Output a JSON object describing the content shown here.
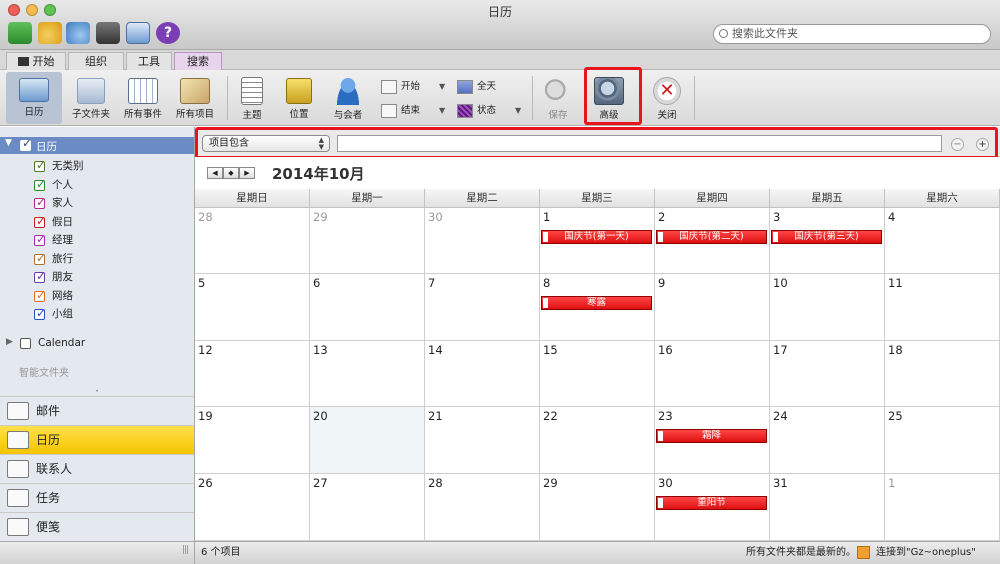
{
  "window": {
    "title": "日历"
  },
  "toolbar": {
    "search_placeholder": "搜索此文件夹",
    "icons": [
      "sync-icon",
      "undo-icon",
      "redo-icon",
      "print-icon",
      "calendar-view-icon",
      "help-icon"
    ]
  },
  "tabs": [
    {
      "label": "开始"
    },
    {
      "label": "组织"
    },
    {
      "label": "工具"
    },
    {
      "label": "搜索",
      "active": true
    }
  ],
  "ribbon": {
    "scope": [
      {
        "label": "日历",
        "icon": "calendar-folder-icon"
      },
      {
        "label": "子文件夹",
        "icon": "subfolder-icon"
      },
      {
        "label": "所有事件",
        "icon": "all-events-icon"
      },
      {
        "label": "所有项目",
        "icon": "all-items-icon"
      }
    ],
    "subject": "主题",
    "location": "位置",
    "attendees": "与会者",
    "start": "开始",
    "end": "结束",
    "allday": "全天",
    "status": "状态",
    "save": "保存",
    "advanced": "高级",
    "close": "关闭"
  },
  "sidebar": {
    "calendar_group": "日历",
    "categories": [
      {
        "label": "无类别",
        "color": "#4a7a2a"
      },
      {
        "label": "个人",
        "color": "#2a8a2a"
      },
      {
        "label": "家人",
        "color": "#b02a8a"
      },
      {
        "label": "假日",
        "color": "#c81e1e"
      },
      {
        "label": "经理",
        "color": "#a030b0"
      },
      {
        "label": "旅行",
        "color": "#b07030"
      },
      {
        "label": "朋友",
        "color": "#6a3ab0"
      },
      {
        "label": "网络",
        "color": "#e07020"
      },
      {
        "label": "小组",
        "color": "#2a50c0"
      }
    ],
    "other_calendar": "Calendar",
    "smart_folder": "智能文件夹",
    "nav": [
      {
        "label": "邮件",
        "icon": "mail-icon"
      },
      {
        "label": "日历",
        "icon": "calendar-icon",
        "active": true
      },
      {
        "label": "联系人",
        "icon": "contacts-icon"
      },
      {
        "label": "任务",
        "icon": "tasks-icon"
      },
      {
        "label": "便笺",
        "icon": "notes-icon"
      }
    ]
  },
  "filter": {
    "criteria": "项目包含",
    "value": "",
    "add": "+",
    "remove": "−"
  },
  "calendar": {
    "month_label": "2014年10月",
    "weekdays": [
      "星期日",
      "星期一",
      "星期二",
      "星期三",
      "星期四",
      "星期五",
      "星期六"
    ],
    "weeks": [
      [
        {
          "d": "28",
          "o": true
        },
        {
          "d": "29",
          "o": true
        },
        {
          "d": "30",
          "o": true
        },
        {
          "d": "1",
          "ev": "国庆节(第一天)"
        },
        {
          "d": "2",
          "ev": "国庆节(第二天)"
        },
        {
          "d": "3",
          "ev": "国庆节(第三天)"
        },
        {
          "d": "4"
        }
      ],
      [
        {
          "d": "5"
        },
        {
          "d": "6"
        },
        {
          "d": "7"
        },
        {
          "d": "8",
          "ev": "寒露"
        },
        {
          "d": "9"
        },
        {
          "d": "10"
        },
        {
          "d": "11"
        }
      ],
      [
        {
          "d": "12"
        },
        {
          "d": "13"
        },
        {
          "d": "14"
        },
        {
          "d": "15"
        },
        {
          "d": "16"
        },
        {
          "d": "17"
        },
        {
          "d": "18"
        }
      ],
      [
        {
          "d": "19"
        },
        {
          "d": "20",
          "today": true
        },
        {
          "d": "21"
        },
        {
          "d": "22"
        },
        {
          "d": "23",
          "ev": "霜降"
        },
        {
          "d": "24"
        },
        {
          "d": "25"
        }
      ],
      [
        {
          "d": "26"
        },
        {
          "d": "27"
        },
        {
          "d": "28"
        },
        {
          "d": "29"
        },
        {
          "d": "30",
          "ev": "重阳节"
        },
        {
          "d": "31"
        },
        {
          "d": "1",
          "o": true
        }
      ]
    ]
  },
  "status": {
    "count": "6 个项目",
    "sync": "所有文件夹都是最新的。",
    "connection": "连接到\"Gz~oneplus\""
  }
}
